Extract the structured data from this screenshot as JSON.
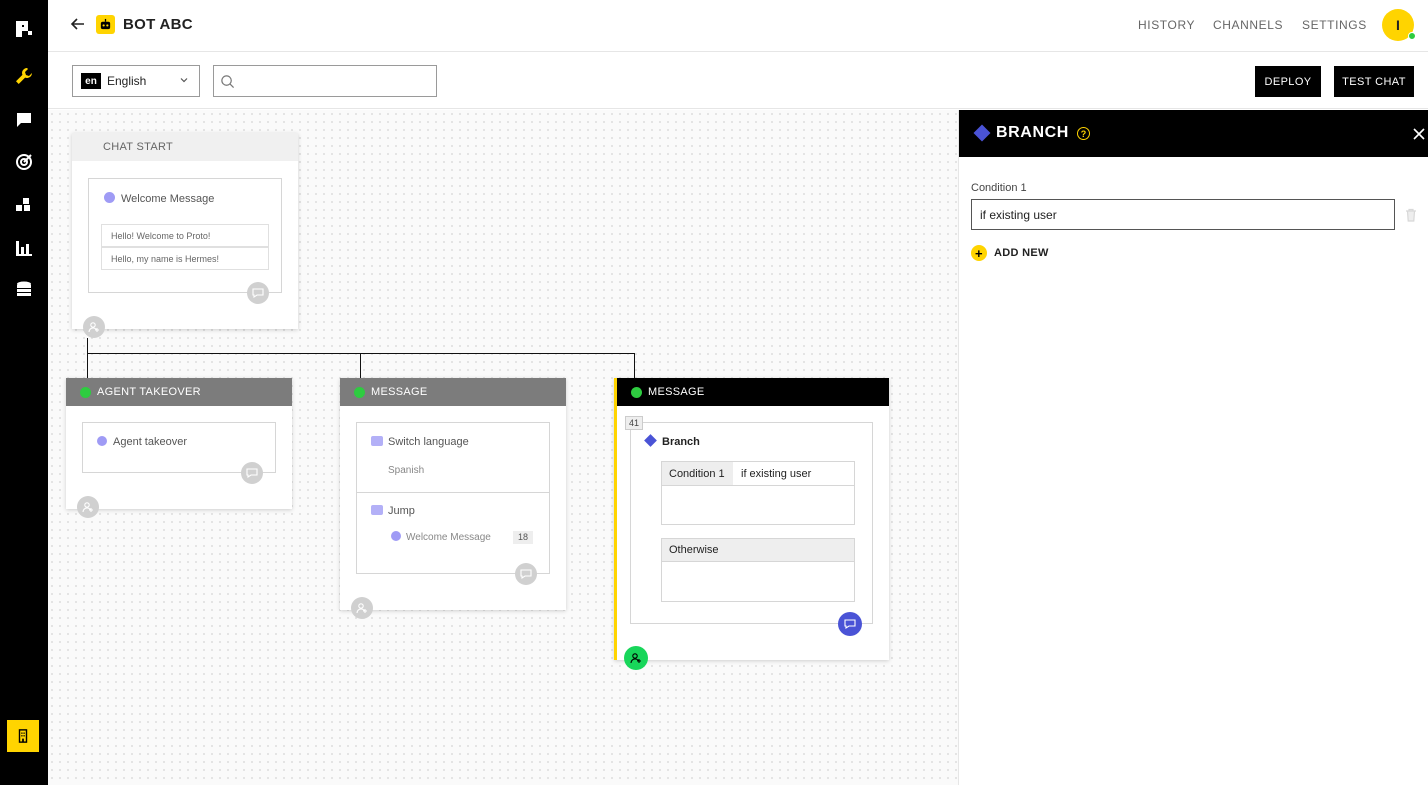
{
  "header": {
    "bot_title": "BOT ABC",
    "nav": [
      "HISTORY",
      "CHANNELS",
      "SETTINGS"
    ],
    "avatar_initial": "I"
  },
  "toolbar": {
    "language_code": "en",
    "language": "English",
    "search_value": "",
    "deploy_label": "DEPLOY",
    "test_chat_label": "TEST CHAT"
  },
  "canvas": {
    "chat_start": {
      "header": "CHAT START",
      "title": "Welcome Message",
      "messages": [
        "Hello! Welcome to Proto!",
        "Hello, my name is Hermes!"
      ]
    },
    "agent_takeover": {
      "header": "AGENT TAKEOVER",
      "title": "Agent takeover"
    },
    "message_1": {
      "header": "MESSAGE",
      "switch_title": "Switch language",
      "switch_value": "Spanish",
      "jump_title": "Jump",
      "jump_target": "Welcome Message",
      "jump_count": "18"
    },
    "message_2": {
      "header": "MESSAGE",
      "badge": "41",
      "branch_title": "Branch",
      "condition_label": "Condition 1",
      "condition_value": "if existing user",
      "otherwise_label": "Otherwise"
    }
  },
  "panel": {
    "title": "BRANCH",
    "help": "?",
    "condition_label": "Condition 1",
    "condition_value": "if existing user",
    "add_new": "ADD NEW"
  },
  "colors": {
    "accent_yellow": "#ffd400",
    "branch_blue": "#4a53d6",
    "online_green": "#2ecc40"
  }
}
